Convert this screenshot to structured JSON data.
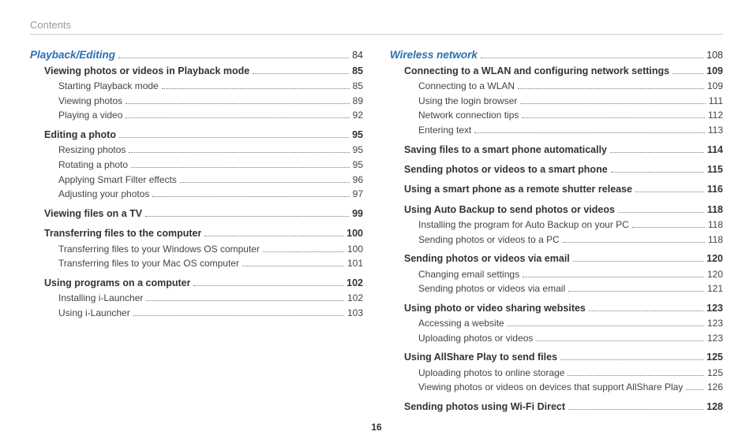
{
  "header": "Contents",
  "page_number": "16",
  "left_column": [
    {
      "level": 0,
      "section_head": true,
      "label": "Playback/Editing",
      "page": "84"
    },
    {
      "level": 1,
      "label": "Viewing photos or videos in Playback mode",
      "page": "85"
    },
    {
      "level": 2,
      "label": "Starting Playback mode",
      "page": "85"
    },
    {
      "level": 2,
      "label": "Viewing photos",
      "page": "89"
    },
    {
      "level": 2,
      "label": "Playing a video",
      "page": "92"
    },
    {
      "level": 1,
      "group_space": true,
      "label": "Editing a photo",
      "page": "95"
    },
    {
      "level": 2,
      "label": "Resizing photos",
      "page": "95"
    },
    {
      "level": 2,
      "label": "Rotating a photo",
      "page": "95"
    },
    {
      "level": 2,
      "label": "Applying Smart Filter effects",
      "page": "96"
    },
    {
      "level": 2,
      "label": "Adjusting your photos",
      "page": "97"
    },
    {
      "level": 1,
      "group_space": true,
      "label": "Viewing files on a TV",
      "page": "99"
    },
    {
      "level": 1,
      "group_space": true,
      "label": "Transferring files to the computer",
      "page": "100"
    },
    {
      "level": 2,
      "label": "Transferring files to your Windows OS computer",
      "page": "100"
    },
    {
      "level": 2,
      "label": "Transferring files to your Mac OS computer",
      "page": "101"
    },
    {
      "level": 1,
      "group_space": true,
      "label": "Using programs on a computer",
      "page": "102"
    },
    {
      "level": 2,
      "label": "Installing i-Launcher",
      "page": "102"
    },
    {
      "level": 2,
      "label": "Using i-Launcher",
      "page": "103"
    }
  ],
  "right_column": [
    {
      "level": 0,
      "section_head": true,
      "label": "Wireless network",
      "page": "108"
    },
    {
      "level": 1,
      "label": "Connecting to a WLAN and configuring network settings",
      "page": "109"
    },
    {
      "level": 2,
      "label": "Connecting to a WLAN",
      "page": "109"
    },
    {
      "level": 2,
      "label": "Using the login browser",
      "page": "111"
    },
    {
      "level": 2,
      "label": "Network connection tips",
      "page": "112"
    },
    {
      "level": 2,
      "label": "Entering text",
      "page": "113"
    },
    {
      "level": 1,
      "group_space": true,
      "label": "Saving files to a smart phone automatically",
      "page": "114"
    },
    {
      "level": 1,
      "group_space": true,
      "label": "Sending photos or videos to a smart phone",
      "page": "115"
    },
    {
      "level": 1,
      "group_space": true,
      "label": "Using a smart phone as a remote shutter release",
      "page": "116"
    },
    {
      "level": 1,
      "group_space": true,
      "label": "Using Auto Backup to send photos or videos",
      "page": "118"
    },
    {
      "level": 2,
      "label": "Installing the program for Auto Backup on your PC",
      "page": "118"
    },
    {
      "level": 2,
      "label": "Sending photos or videos to a PC",
      "page": "118"
    },
    {
      "level": 1,
      "group_space": true,
      "label": "Sending photos or videos via email",
      "page": "120"
    },
    {
      "level": 2,
      "label": "Changing email settings",
      "page": "120"
    },
    {
      "level": 2,
      "label": "Sending photos or videos via email",
      "page": "121"
    },
    {
      "level": 1,
      "group_space": true,
      "label": "Using photo or video sharing websites",
      "page": "123"
    },
    {
      "level": 2,
      "label": "Accessing a website",
      "page": "123"
    },
    {
      "level": 2,
      "label": "Uploading photos or videos",
      "page": "123"
    },
    {
      "level": 1,
      "group_space": true,
      "label": "Using AllShare Play to send files",
      "page": "125"
    },
    {
      "level": 2,
      "label": "Uploading photos to online storage",
      "page": "125"
    },
    {
      "level": 2,
      "label": "Viewing photos or videos on devices that support AllShare Play",
      "page": "126"
    },
    {
      "level": 1,
      "group_space": true,
      "label": "Sending photos using Wi-Fi Direct",
      "page": "128"
    }
  ]
}
